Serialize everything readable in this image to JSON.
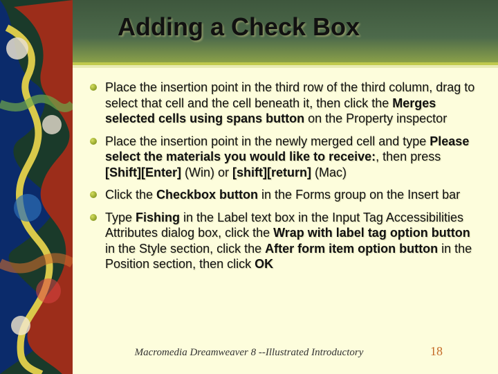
{
  "title": "Adding a Check Box",
  "bullets": [
    {
      "pre1": "Place the insertion point in the third row of the third column, drag to select that cell and the cell beneath it, then click the ",
      "bold1": "Merges selected cells using spans button",
      "post1": " on the Property inspector"
    },
    {
      "pre1": "Place the insertion point in the newly merged cell and type ",
      "bold1": "Please select the materials you would like to receive:",
      "mid1": ", then press ",
      "bold2": "[Shift][Enter]",
      "mid2": " (Win) or ",
      "bold3": "[shift][return]",
      "post1": " (Mac)"
    },
    {
      "pre1": "Click the ",
      "bold1": "Checkbox button",
      "post1": " in the Forms group on the Insert bar"
    },
    {
      "pre1": "Type ",
      "bold1": "Fishing",
      "mid1": " in the Label text box in the Input Tag Accessibilities Attributes dialog box, click the ",
      "bold2": "Wrap with label tag option button",
      "mid2": " in the Style section, click the ",
      "bold3": "After form item option button",
      "mid3": " in the Position section, then click ",
      "bold4": "OK"
    }
  ],
  "footer": "Macromedia Dreamweaver 8 --Illustrated Introductory",
  "page": "18"
}
